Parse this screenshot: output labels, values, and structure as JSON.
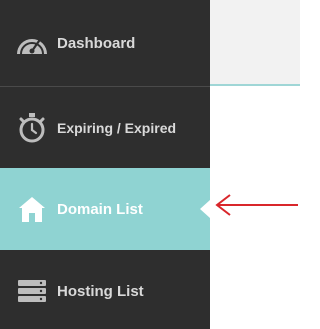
{
  "sidebar": {
    "items": [
      {
        "label": "Dashboard",
        "icon": "speedometer-icon",
        "active": false
      },
      {
        "label": "Expiring / Expired",
        "icon": "stopwatch-icon",
        "active": false
      },
      {
        "label": "Domain List",
        "icon": "home-icon",
        "active": true
      },
      {
        "label": "Hosting List",
        "icon": "server-icon",
        "active": false
      }
    ]
  },
  "colors": {
    "sidebar_bg": "#2e2e2e",
    "active_bg": "#8fd3d2",
    "annotation_arrow": "#d9262b"
  }
}
